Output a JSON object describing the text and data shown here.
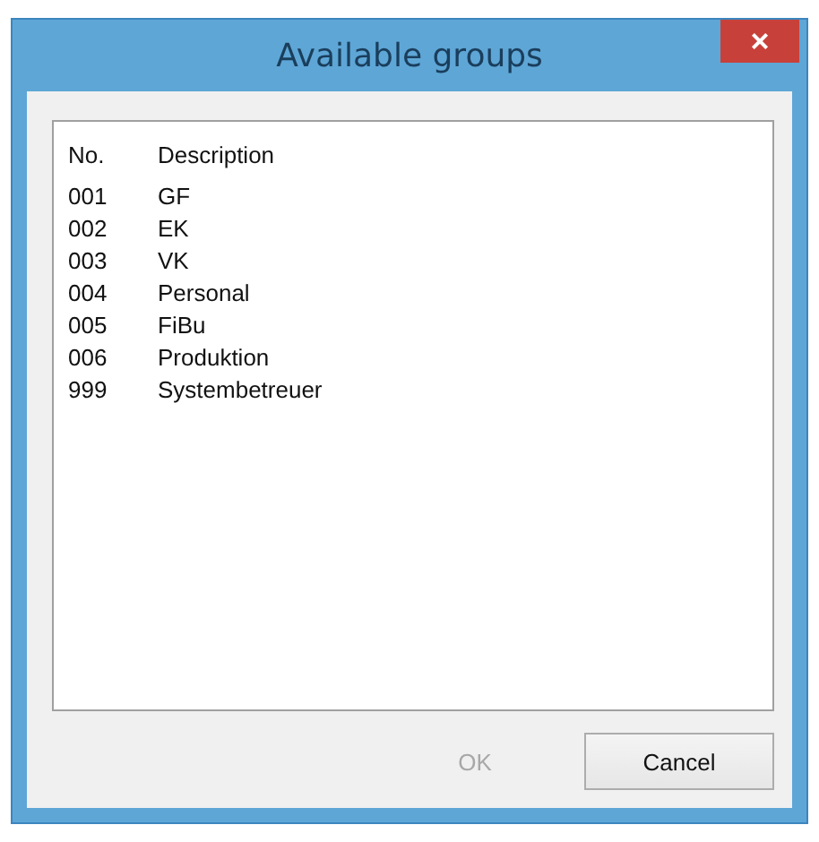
{
  "window": {
    "title": "Available groups",
    "close_icon": "×"
  },
  "table": {
    "columns": [
      "No.",
      "Description"
    ],
    "rows": [
      {
        "no": "001",
        "description": "GF"
      },
      {
        "no": "002",
        "description": "EK"
      },
      {
        "no": "003",
        "description": "VK"
      },
      {
        "no": "004",
        "description": "Personal"
      },
      {
        "no": "005",
        "description": "FiBu"
      },
      {
        "no": "006",
        "description": "Produktion"
      },
      {
        "no": "999",
        "description": "Systembetreuer"
      }
    ]
  },
  "buttons": [
    {
      "label": "OK",
      "disabled": true
    },
    {
      "label": "Cancel",
      "disabled": false
    }
  ]
}
